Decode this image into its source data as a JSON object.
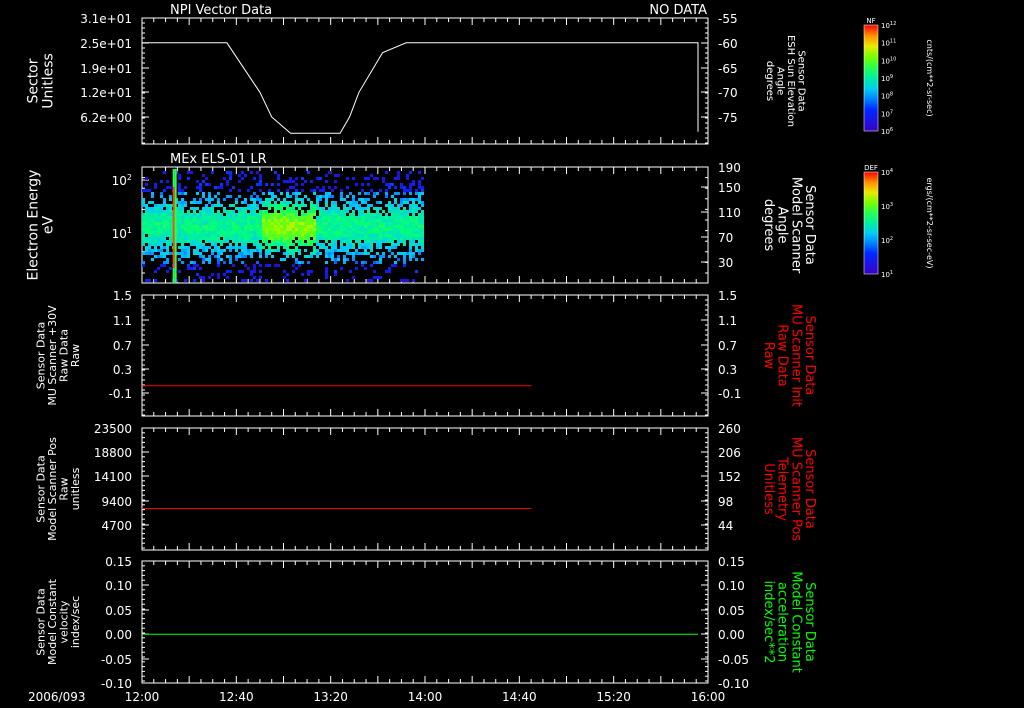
{
  "figure": {
    "date_label": "2006/093",
    "x_ticks": [
      "12:00",
      "12:40",
      "13:20",
      "14:00",
      "14:40",
      "15:20",
      "16:00"
    ],
    "x_minutes": [
      0,
      40,
      80,
      120,
      160,
      200,
      240
    ]
  },
  "chart_data": [
    {
      "type": "line",
      "title": "NPI Vector Data",
      "status": "NO DATA",
      "ylabel": "Sector\nUnitless",
      "yticks": [
        "3.1e+01",
        "2.5e+01",
        "1.9e+01",
        "1.2e+01",
        "6.2e+00"
      ],
      "right_ylabel": "Sensor Data\nESH Sun Elevation\nAngle\ndegrees",
      "right_yticks": [
        "-55",
        "-60",
        "-65",
        "-70",
        "-75"
      ],
      "right_ylim": [
        -80,
        -55
      ],
      "color": "#ffffff",
      "series": [
        {
          "x": [
            0,
            36,
            50,
            55,
            63,
            76,
            84,
            88,
            92,
            102,
            112,
            256,
            266,
            276,
            281,
            285,
            300
          ],
          "y": [
            -60,
            -60,
            -70,
            -75,
            -78.3,
            -78.3,
            -78.3,
            -75,
            -70,
            -62,
            -60,
            -60,
            -65,
            -70,
            -75,
            -78,
            -78
          ]
        }
      ],
      "colorbar": {
        "title": "NF",
        "unit": "cnts/(cm**2-sr-sec)",
        "ticks": [
          "10^12",
          "10^11",
          "10^10",
          "10^9",
          "10^8",
          "10^7",
          "10^6"
        ]
      }
    },
    {
      "type": "heatmap",
      "title": "MEx ELS-01 LR",
      "ylabel": "Electron Energy\neV",
      "yticks": [
        "10^2",
        "10^1"
      ],
      "right_ylabel": "Sensor Data\nModel Scanner\nAngle\ndegrees",
      "right_yticks": [
        "190",
        "150",
        "110",
        "70",
        "30"
      ],
      "data_x_range": [
        0,
        120
      ],
      "colorbar": {
        "title": "DEF",
        "unit": "ergs/(cm**2-sr-sec-eV)",
        "ticks": [
          "10^4",
          "10^3",
          "10^2",
          "10^1"
        ]
      }
    },
    {
      "type": "line",
      "ylabel": "Sensor Data\nMU Scanner +30V\nRaw Data\nRaw",
      "yticks": [
        "1.5",
        "1.1",
        "0.7",
        "0.3",
        "-0.1"
      ],
      "ylim": [
        -0.5,
        1.5
      ],
      "right_ylabel": "Sensor Data\nMU Scanner Init\nRaw Data\nRaw",
      "right_yticks": [
        "1.5",
        "1.1",
        "0.7",
        "0.3",
        "-0.1"
      ],
      "color": "#ff0000",
      "series": [
        {
          "x": [
            0,
            165
          ],
          "y": [
            0,
            0
          ]
        }
      ]
    },
    {
      "type": "line",
      "ylabel": "Sensor Data\nModel Scanner Pos\nRaw\nunitless",
      "yticks": [
        "23500",
        "18800",
        "14100",
        "9400",
        "4700"
      ],
      "ylim": [
        0,
        23500
      ],
      "right_ylabel": "Sensor Data\nMU Scanner Pos\nTelemetry\nUnitless",
      "right_yticks": [
        "260",
        "206",
        "152",
        "98",
        "44"
      ],
      "color": "#ff0000",
      "series": [
        {
          "x": [
            0,
            165
          ],
          "y": [
            8000,
            8000
          ]
        }
      ]
    },
    {
      "type": "line",
      "ylabel": "Sensor Data\nModel Constant\nvelocity\nindex/sec",
      "yticks": [
        "0.15",
        "0.10",
        "0.05",
        "0.00",
        "-0.05",
        "-0.10"
      ],
      "ylim": [
        -0.1,
        0.15
      ],
      "right_ylabel": "Sensor Data\nModel Constant\nacceleration\nindex/sec**2",
      "right_yticks": [
        "0.15",
        "0.10",
        "0.05",
        "0.00",
        "-0.05",
        "-0.10"
      ],
      "color": "#00ff00",
      "series": [
        {
          "x": [
            0,
            240
          ],
          "y": [
            0,
            0
          ]
        }
      ]
    }
  ],
  "colors": {
    "axis": "#ffffff",
    "red_label": "#ff0000",
    "green_label": "#00ff00"
  }
}
